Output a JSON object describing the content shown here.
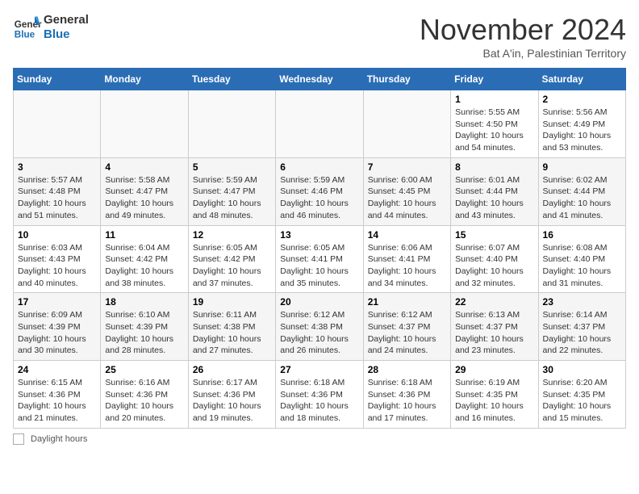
{
  "logo": {
    "line1": "General",
    "line2": "Blue"
  },
  "title": "November 2024",
  "location": "Bat A'in, Palestinian Territory",
  "legend": "Daylight hours",
  "days_of_week": [
    "Sunday",
    "Monday",
    "Tuesday",
    "Wednesday",
    "Thursday",
    "Friday",
    "Saturday"
  ],
  "weeks": [
    [
      {
        "day": "",
        "info": ""
      },
      {
        "day": "",
        "info": ""
      },
      {
        "day": "",
        "info": ""
      },
      {
        "day": "",
        "info": ""
      },
      {
        "day": "",
        "info": ""
      },
      {
        "day": "1",
        "info": "Sunrise: 5:55 AM\nSunset: 4:50 PM\nDaylight: 10 hours and 54 minutes."
      },
      {
        "day": "2",
        "info": "Sunrise: 5:56 AM\nSunset: 4:49 PM\nDaylight: 10 hours and 53 minutes."
      }
    ],
    [
      {
        "day": "3",
        "info": "Sunrise: 5:57 AM\nSunset: 4:48 PM\nDaylight: 10 hours and 51 minutes."
      },
      {
        "day": "4",
        "info": "Sunrise: 5:58 AM\nSunset: 4:47 PM\nDaylight: 10 hours and 49 minutes."
      },
      {
        "day": "5",
        "info": "Sunrise: 5:59 AM\nSunset: 4:47 PM\nDaylight: 10 hours and 48 minutes."
      },
      {
        "day": "6",
        "info": "Sunrise: 5:59 AM\nSunset: 4:46 PM\nDaylight: 10 hours and 46 minutes."
      },
      {
        "day": "7",
        "info": "Sunrise: 6:00 AM\nSunset: 4:45 PM\nDaylight: 10 hours and 44 minutes."
      },
      {
        "day": "8",
        "info": "Sunrise: 6:01 AM\nSunset: 4:44 PM\nDaylight: 10 hours and 43 minutes."
      },
      {
        "day": "9",
        "info": "Sunrise: 6:02 AM\nSunset: 4:44 PM\nDaylight: 10 hours and 41 minutes."
      }
    ],
    [
      {
        "day": "10",
        "info": "Sunrise: 6:03 AM\nSunset: 4:43 PM\nDaylight: 10 hours and 40 minutes."
      },
      {
        "day": "11",
        "info": "Sunrise: 6:04 AM\nSunset: 4:42 PM\nDaylight: 10 hours and 38 minutes."
      },
      {
        "day": "12",
        "info": "Sunrise: 6:05 AM\nSunset: 4:42 PM\nDaylight: 10 hours and 37 minutes."
      },
      {
        "day": "13",
        "info": "Sunrise: 6:05 AM\nSunset: 4:41 PM\nDaylight: 10 hours and 35 minutes."
      },
      {
        "day": "14",
        "info": "Sunrise: 6:06 AM\nSunset: 4:41 PM\nDaylight: 10 hours and 34 minutes."
      },
      {
        "day": "15",
        "info": "Sunrise: 6:07 AM\nSunset: 4:40 PM\nDaylight: 10 hours and 32 minutes."
      },
      {
        "day": "16",
        "info": "Sunrise: 6:08 AM\nSunset: 4:40 PM\nDaylight: 10 hours and 31 minutes."
      }
    ],
    [
      {
        "day": "17",
        "info": "Sunrise: 6:09 AM\nSunset: 4:39 PM\nDaylight: 10 hours and 30 minutes."
      },
      {
        "day": "18",
        "info": "Sunrise: 6:10 AM\nSunset: 4:39 PM\nDaylight: 10 hours and 28 minutes."
      },
      {
        "day": "19",
        "info": "Sunrise: 6:11 AM\nSunset: 4:38 PM\nDaylight: 10 hours and 27 minutes."
      },
      {
        "day": "20",
        "info": "Sunrise: 6:12 AM\nSunset: 4:38 PM\nDaylight: 10 hours and 26 minutes."
      },
      {
        "day": "21",
        "info": "Sunrise: 6:12 AM\nSunset: 4:37 PM\nDaylight: 10 hours and 24 minutes."
      },
      {
        "day": "22",
        "info": "Sunrise: 6:13 AM\nSunset: 4:37 PM\nDaylight: 10 hours and 23 minutes."
      },
      {
        "day": "23",
        "info": "Sunrise: 6:14 AM\nSunset: 4:37 PM\nDaylight: 10 hours and 22 minutes."
      }
    ],
    [
      {
        "day": "24",
        "info": "Sunrise: 6:15 AM\nSunset: 4:36 PM\nDaylight: 10 hours and 21 minutes."
      },
      {
        "day": "25",
        "info": "Sunrise: 6:16 AM\nSunset: 4:36 PM\nDaylight: 10 hours and 20 minutes."
      },
      {
        "day": "26",
        "info": "Sunrise: 6:17 AM\nSunset: 4:36 PM\nDaylight: 10 hours and 19 minutes."
      },
      {
        "day": "27",
        "info": "Sunrise: 6:18 AM\nSunset: 4:36 PM\nDaylight: 10 hours and 18 minutes."
      },
      {
        "day": "28",
        "info": "Sunrise: 6:18 AM\nSunset: 4:36 PM\nDaylight: 10 hours and 17 minutes."
      },
      {
        "day": "29",
        "info": "Sunrise: 6:19 AM\nSunset: 4:35 PM\nDaylight: 10 hours and 16 minutes."
      },
      {
        "day": "30",
        "info": "Sunrise: 6:20 AM\nSunset: 4:35 PM\nDaylight: 10 hours and 15 minutes."
      }
    ]
  ]
}
